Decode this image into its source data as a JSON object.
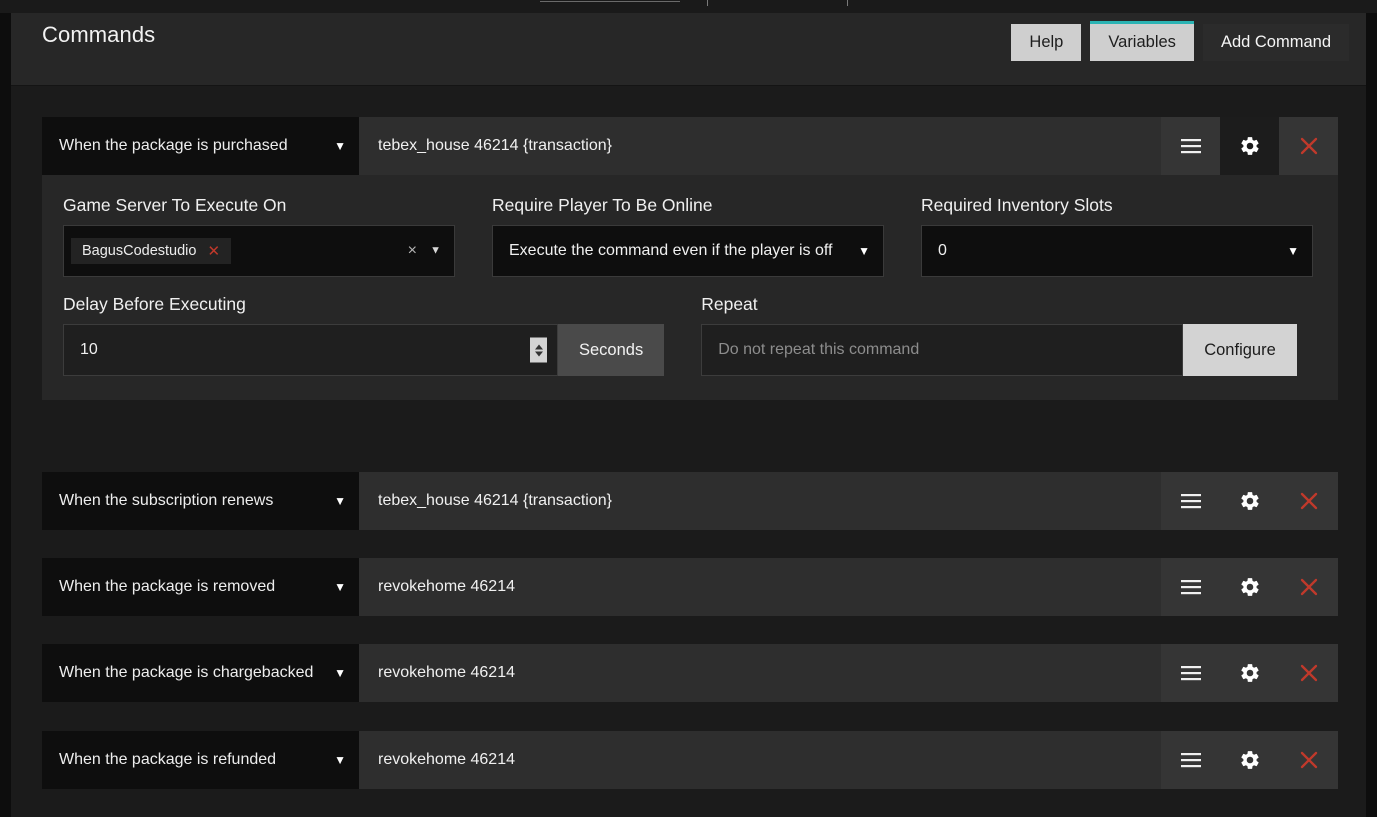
{
  "header": {
    "title": "Commands",
    "buttons": [
      {
        "label": "Help",
        "style": "light",
        "name": "help-button"
      },
      {
        "label": "Variables",
        "style": "light",
        "name": "variables-button"
      },
      {
        "label": "Add Command",
        "style": "dark",
        "name": "add-command-button"
      }
    ],
    "accent_color": "#2bb3b3"
  },
  "icons": {
    "caret_down": "▼",
    "small_caret_down": "▼",
    "clear_x": "×",
    "tag_x": "✕"
  },
  "commands": [
    {
      "trigger": "When the package is purchased",
      "command": "tebex_house 46214 {transaction}",
      "expanded": true,
      "settings": {
        "game_server": {
          "label": "Game Server To Execute On",
          "tags": [
            "BagusCodestudio"
          ]
        },
        "require_online": {
          "label": "Require Player To Be Online",
          "value": "Execute the command even if the player is off"
        },
        "inventory_slots": {
          "label": "Required Inventory Slots",
          "value": "0"
        },
        "delay": {
          "label": "Delay Before Executing",
          "value": "10",
          "unit": "Seconds"
        },
        "repeat": {
          "label": "Repeat",
          "placeholder": "Do not repeat this command",
          "button": "Configure"
        }
      }
    },
    {
      "trigger": "When the subscription renews",
      "command": "tebex_house 46214 {transaction}",
      "expanded": false
    },
    {
      "trigger": "When the package is removed",
      "command": "revokehome 46214",
      "expanded": false
    },
    {
      "trigger": "When the package is chargebacked",
      "command": "revokehome 46214",
      "expanded": false
    },
    {
      "trigger": "When the package is refunded",
      "command": "revokehome 46214",
      "expanded": false
    }
  ]
}
